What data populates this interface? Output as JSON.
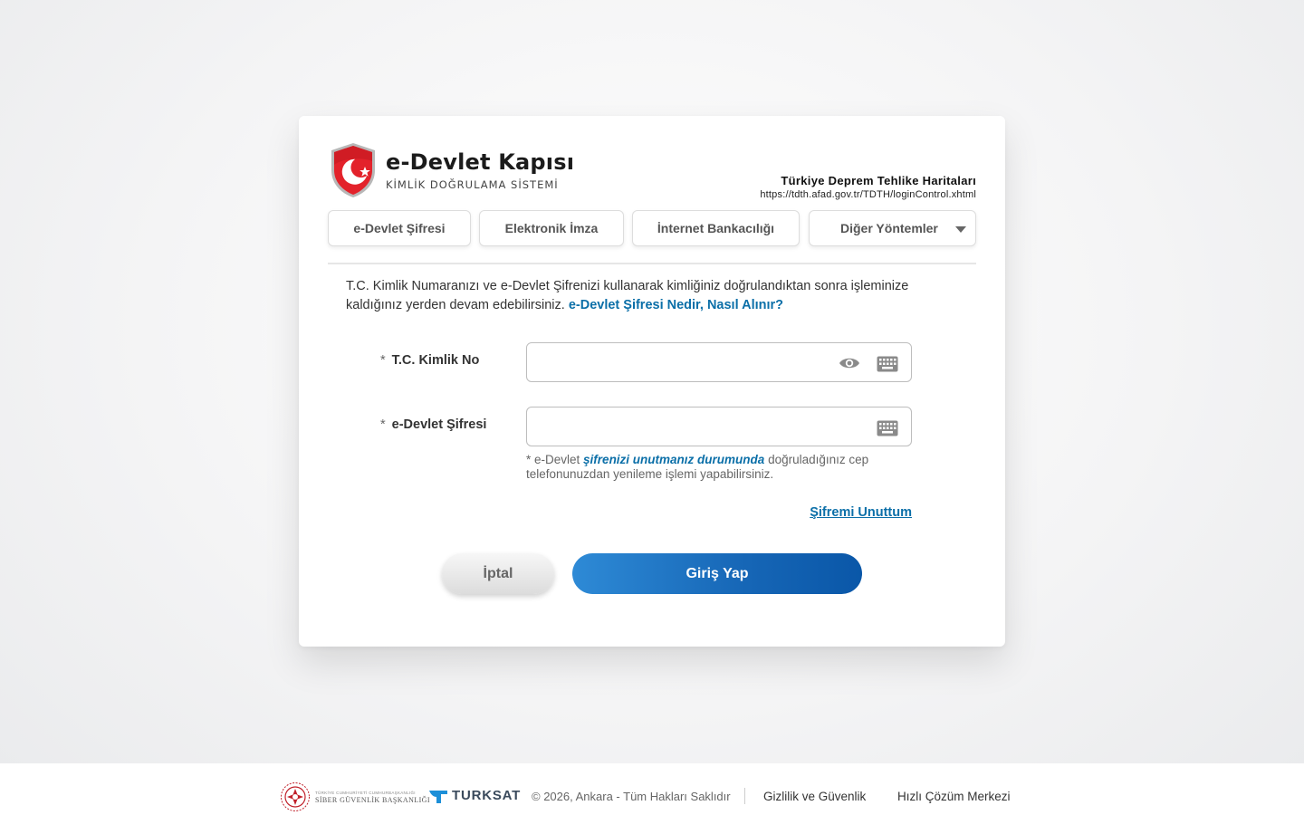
{
  "logo": {
    "title": "e-Devlet Kapısı",
    "subtitle": "KİMLİK DOĞRULAMA SİSTEMİ",
    "icon": "shield-crescent-star-icon"
  },
  "app": {
    "name": "Türkiye Deprem Tehlike Haritaları",
    "url": "https://tdth.afad.gov.tr/TDTH/loginControl.xhtml"
  },
  "tabs": [
    {
      "label": "e-Devlet Şifresi"
    },
    {
      "label": "Elektronik İmza"
    },
    {
      "label": "İnternet Bankacılığı"
    },
    {
      "label": "Diğer Yöntemler"
    }
  ],
  "intro": {
    "text": "T.C. Kimlik Numaranızı ve e-Devlet Şifrenizi kullanarak kimliğiniz doğrulandıktan sonra işleminize kaldığınız yerden devam edebilirsiniz.",
    "link": "e-Devlet Şifresi Nedir, Nasıl Alınır?"
  },
  "form": {
    "required_mark": "*",
    "tc_label": "T.C. Kimlik No",
    "tc_value": "",
    "password_label": "e-Devlet Şifresi",
    "password_value": "",
    "hint_prefix": "* e-Devlet",
    "hint_link": "şifrenizi unutmanız durumunda",
    "hint_suffix": "doğruladığınız cep telefonunuzdan yenileme işlemi yapabilirsiniz.",
    "forgot": "Şifremi Unuttum",
    "cancel": "İptal",
    "login": "Giriş Yap"
  },
  "colors": {
    "link": "#0b6fa8",
    "login_button": "#1666b6",
    "shield_red": "#e3222b"
  },
  "footer": {
    "siber_small": "TÜRKİYE CUMHURİYETİ CUMHURBAŞKANLIĞI",
    "siber_big": "SİBER GÜVENLİK BAŞKANLIĞI",
    "turksat": "TURKSAT",
    "copyright": "© 2026, Ankara - Tüm Hakları Saklıdır",
    "privacy": "Gizlilik ve Güvenlik",
    "help": "Hızlı Çözüm Merkezi"
  }
}
